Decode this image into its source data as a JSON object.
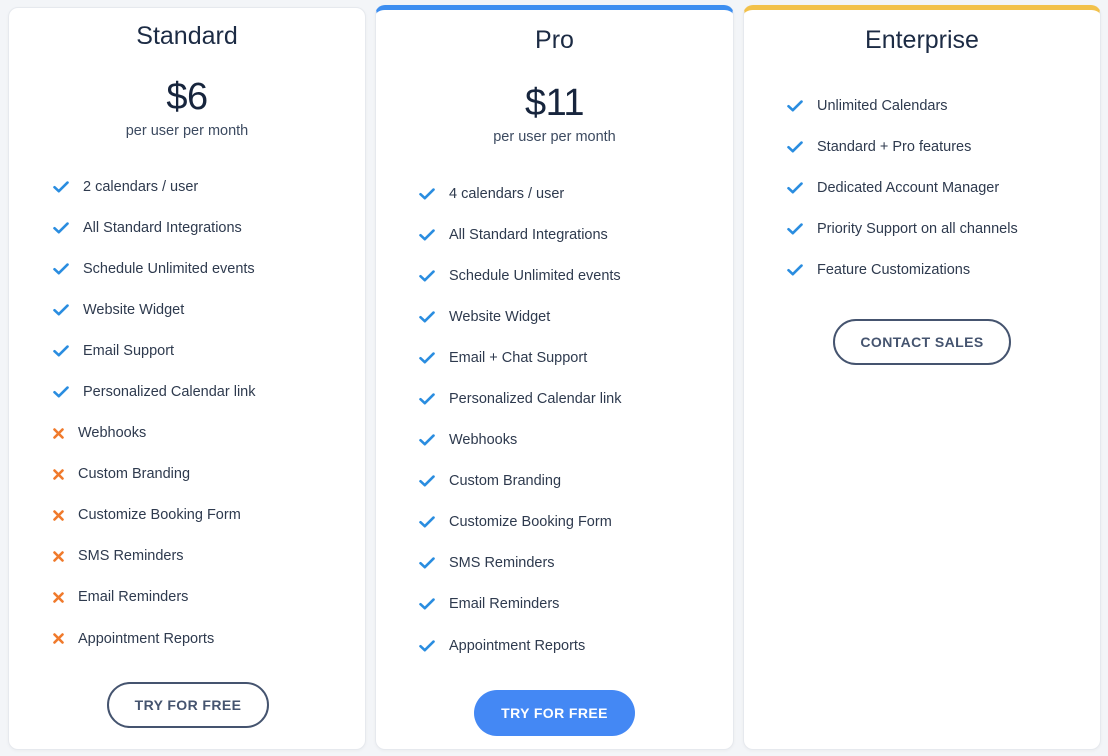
{
  "colors": {
    "check": "#2a8de0",
    "cross": "#f07a2c",
    "pro_accent": "#3d8ef0",
    "enterprise_accent": "#f2c14a",
    "pro_button": "#4488f4",
    "outline_button": "#45546f"
  },
  "plans": [
    {
      "name": "Standard",
      "price": "$6",
      "period": "per user per month",
      "features": [
        {
          "label": "2 calendars / user",
          "icon": "check-icon"
        },
        {
          "label": "All Standard Integrations",
          "icon": "check-icon"
        },
        {
          "label": "Schedule Unlimited events",
          "icon": "check-icon"
        },
        {
          "label": "Website Widget",
          "icon": "check-icon"
        },
        {
          "label": "Email Support",
          "icon": "check-icon"
        },
        {
          "label": "Personalized Calendar link",
          "icon": "check-icon"
        },
        {
          "label": "Webhooks",
          "icon": "cross-icon"
        },
        {
          "label": "Custom Branding",
          "icon": "cross-icon"
        },
        {
          "label": "Customize Booking Form",
          "icon": "cross-icon"
        },
        {
          "label": "SMS Reminders",
          "icon": "cross-icon"
        },
        {
          "label": "Email Reminders",
          "icon": "cross-icon"
        },
        {
          "label": "Appointment Reports",
          "icon": "cross-icon"
        }
      ],
      "button_label": "TRY FOR FREE"
    },
    {
      "name": "Pro",
      "price": "$11",
      "period": "per user per month",
      "features": [
        {
          "label": "4 calendars / user",
          "icon": "check-icon"
        },
        {
          "label": "All Standard Integrations",
          "icon": "check-icon"
        },
        {
          "label": "Schedule Unlimited events",
          "icon": "check-icon"
        },
        {
          "label": "Website Widget",
          "icon": "check-icon"
        },
        {
          "label": "Email + Chat Support",
          "icon": "check-icon"
        },
        {
          "label": "Personalized Calendar link",
          "icon": "check-icon"
        },
        {
          "label": "Webhooks",
          "icon": "check-icon"
        },
        {
          "label": "Custom Branding",
          "icon": "check-icon"
        },
        {
          "label": "Customize Booking Form",
          "icon": "check-icon"
        },
        {
          "label": "SMS Reminders",
          "icon": "check-icon"
        },
        {
          "label": "Email Reminders",
          "icon": "check-icon"
        },
        {
          "label": "Appointment Reports",
          "icon": "check-icon"
        }
      ],
      "button_label": "TRY FOR FREE"
    },
    {
      "name": "Enterprise",
      "features": [
        {
          "label": "Unlimited Calendars",
          "icon": "check-icon"
        },
        {
          "label": "Standard + Pro features",
          "icon": "check-icon"
        },
        {
          "label": "Dedicated Account Manager",
          "icon": "check-icon"
        },
        {
          "label": "Priority Support on all channels",
          "icon": "check-icon"
        },
        {
          "label": "Feature Customizations",
          "icon": "check-icon"
        }
      ],
      "button_label": "CONTACT SALES"
    }
  ]
}
